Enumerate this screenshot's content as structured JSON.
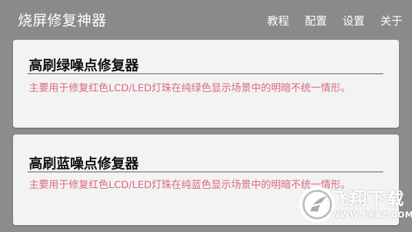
{
  "app": {
    "title": "烧屏修复神器",
    "background_color": "#8a8a8a"
  },
  "menu": [
    {
      "label": "教程"
    },
    {
      "label": "配置"
    },
    {
      "label": "设置"
    },
    {
      "label": "关于"
    }
  ],
  "cards": [
    {
      "title": "高刷绿噪点修复器",
      "description": "主要用于修复红色LCD/LED灯珠在纯绿色显示场景中的明暗不统一情形。"
    },
    {
      "title": "高刷蓝噪点修复器",
      "description": "主要用于修复红色LCD/LED灯珠在纯蓝色显示场景中的明暗不统一情形。"
    }
  ],
  "colors": {
    "accent_text": "#d86a7c",
    "card_bg": "#f3f3f3"
  },
  "watermark": {
    "text": "飞翔下载",
    "url": "WWW.FXXZ.COM",
    "logo_icon": "fxxz-logo-icon"
  }
}
